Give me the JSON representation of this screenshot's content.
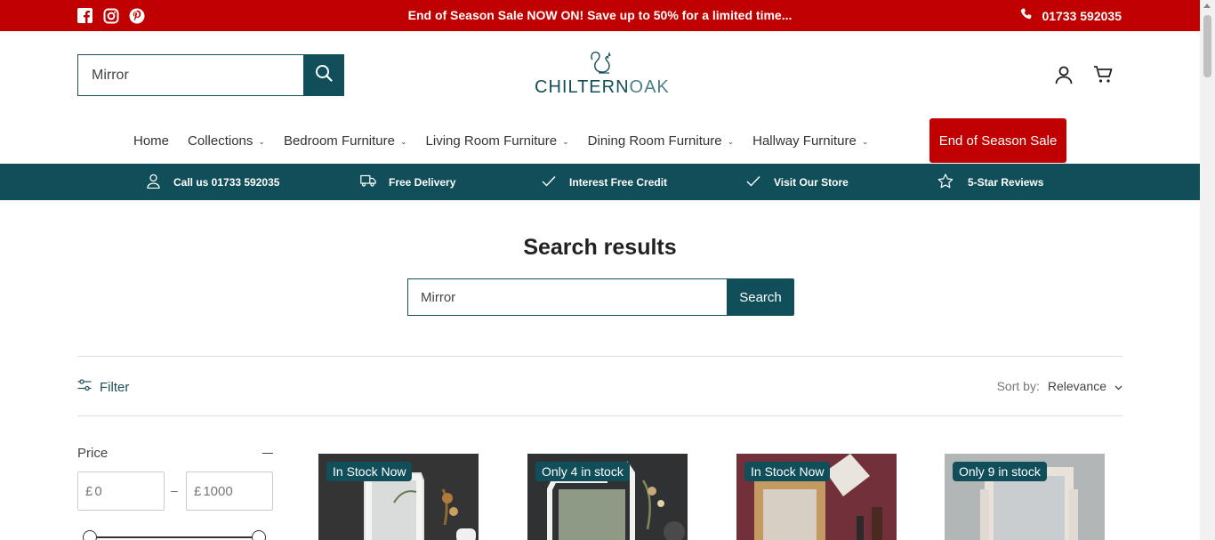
{
  "topbar": {
    "promo": "End of Season Sale NOW ON! Save up to 50% for a limited time...",
    "phone": "01733 592035",
    "social": [
      "facebook-icon",
      "instagram-icon",
      "pinterest-icon"
    ]
  },
  "header": {
    "search_value": "Mirror",
    "logo_main": "CHILTERN",
    "logo_accent": "OAK"
  },
  "nav": {
    "items": [
      {
        "label": "Home"
      },
      {
        "label": "Collections"
      },
      {
        "label": "Bedroom Furniture"
      },
      {
        "label": "Living Room Furniture"
      },
      {
        "label": "Dining Room Furniture"
      },
      {
        "label": "Hallway Furniture"
      }
    ],
    "sale": "End of Season Sale"
  },
  "usp": [
    {
      "label": "Call us 01733 592035",
      "icon": "user-icon"
    },
    {
      "label": "Free Delivery",
      "icon": "truck-icon"
    },
    {
      "label": "Interest Free Credit",
      "icon": "check-icon"
    },
    {
      "label": "Visit Our Store",
      "icon": "check-icon"
    },
    {
      "label": "5-Star Reviews",
      "icon": "star-icon"
    }
  ],
  "main": {
    "title": "Search results",
    "search_value": "Mirror",
    "search_button": "Search",
    "filter_label": "Filter",
    "sort_label": "Sort by:",
    "sort_value": "Relevance",
    "price_label": "Price",
    "currency": "£",
    "price_min": "0",
    "price_max": "1000",
    "price_dash": "–"
  },
  "products": [
    {
      "badge": "In Stock Now"
    },
    {
      "badge": "Only 4 in stock"
    },
    {
      "badge": "In Stock Now"
    },
    {
      "badge": "Only 9 in stock"
    }
  ],
  "colors": {
    "brand_red": "#c00000",
    "brand_teal": "#104e59"
  }
}
